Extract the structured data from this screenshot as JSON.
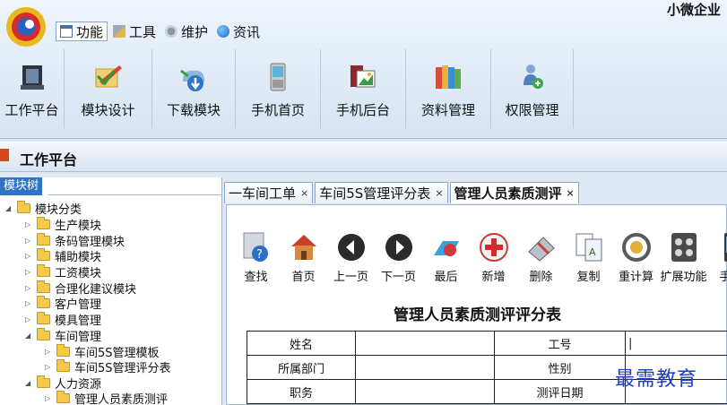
{
  "app": {
    "corner_title": "小微企业"
  },
  "menu": {
    "items": [
      {
        "label": "功能",
        "icon": "window-icon"
      },
      {
        "label": "工具",
        "icon": "tools-icon"
      },
      {
        "label": "维护",
        "icon": "maintenance-icon"
      },
      {
        "label": "资讯",
        "icon": "globe-icon"
      }
    ]
  },
  "ribbon": {
    "items": [
      {
        "label": "工作平台",
        "icon": "workbench-icon"
      },
      {
        "label": "模块设计",
        "icon": "design-icon"
      },
      {
        "label": "下载模块",
        "icon": "download-icon"
      },
      {
        "label": "手机首页",
        "icon": "phone-icon"
      },
      {
        "label": "手机后台",
        "icon": "phone-admin-icon"
      },
      {
        "label": "资料管理",
        "icon": "books-icon"
      },
      {
        "label": "权限管理",
        "icon": "user-permission-icon"
      }
    ]
  },
  "platform": {
    "title": "工作平台"
  },
  "tree": {
    "tab_label": "模块树",
    "nodes": [
      {
        "label": "模块分类",
        "expanded": true
      },
      {
        "label": "生产模块"
      },
      {
        "label": "条码管理模块"
      },
      {
        "label": "辅助模块"
      },
      {
        "label": "工资模块"
      },
      {
        "label": "合理化建议模块"
      },
      {
        "label": "客户管理"
      },
      {
        "label": "模具管理"
      },
      {
        "label": "车间管理",
        "expanded": true
      },
      {
        "label": "车间5S管理模板"
      },
      {
        "label": "车间5S管理评分表"
      },
      {
        "label": "人力资源",
        "expanded": true
      },
      {
        "label": "管理人员素质测评"
      }
    ]
  },
  "tabs": [
    {
      "label": "一车间工单",
      "close": "×"
    },
    {
      "label": "车间5S管理评分表",
      "close": "×"
    },
    {
      "label": "管理人员素质测评",
      "close": "×"
    }
  ],
  "toolbar": {
    "items": [
      {
        "label": "查找",
        "icon": "find-icon"
      },
      {
        "label": "首页",
        "icon": "home-icon"
      },
      {
        "label": "上一页",
        "icon": "prev-icon"
      },
      {
        "label": "下一页",
        "icon": "next-icon"
      },
      {
        "label": "最后",
        "icon": "last-icon"
      },
      {
        "label": "新增",
        "icon": "add-icon"
      },
      {
        "label": "删除",
        "icon": "delete-icon"
      },
      {
        "label": "复制",
        "icon": "copy-icon"
      },
      {
        "label": "重计算",
        "icon": "recalc-icon"
      },
      {
        "label": "扩展功能",
        "icon": "calculator-icon"
      },
      {
        "label": "手机",
        "icon": "mobile-icon"
      }
    ]
  },
  "form": {
    "title": "管理人员素质测评评分表",
    "rows": [
      {
        "label1": "姓名",
        "value1": "",
        "label2": "工号",
        "value2": "|"
      },
      {
        "label1": "所属部门",
        "value1": "",
        "label2": "性别",
        "value2": ""
      },
      {
        "label1": "职务",
        "value1": "",
        "label2": "测评日期",
        "value2": ""
      }
    ]
  },
  "watermark": {
    "text": "最需教育"
  }
}
